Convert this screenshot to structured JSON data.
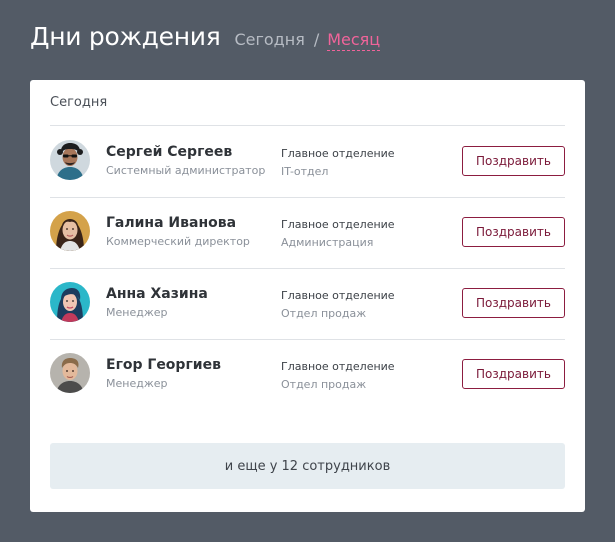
{
  "header": {
    "title": "Дни рождения",
    "tabs": [
      {
        "label": "Сегодня",
        "active": false
      },
      {
        "label": "Месяц",
        "active": true
      }
    ],
    "separator": "/"
  },
  "card": {
    "caption": "Сегодня",
    "people": [
      {
        "name": "Сергей Сергеев",
        "role": "Системный администратор",
        "department": "Главное отделение",
        "subdepartment": "IT-отдел",
        "action": "Поздравить"
      },
      {
        "name": "Галина Иванова",
        "role": "Коммерческий директор",
        "department": "Главное отделение",
        "subdepartment": "Администрация",
        "action": "Поздравить"
      },
      {
        "name": "Анна Хазина",
        "role": "Менеджер",
        "department": "Главное отделение",
        "subdepartment": "Отдел продаж",
        "action": "Поздравить"
      },
      {
        "name": "Егор Георгиев",
        "role": "Менеджер",
        "department": "Главное отделение",
        "subdepartment": "Отдел продаж",
        "action": "Поздравить"
      }
    ],
    "more_label": "и еще у 12 сотрудников"
  },
  "colors": {
    "background": "#535b66",
    "accent": "#f0649a",
    "button_border": "#8c1d40"
  }
}
